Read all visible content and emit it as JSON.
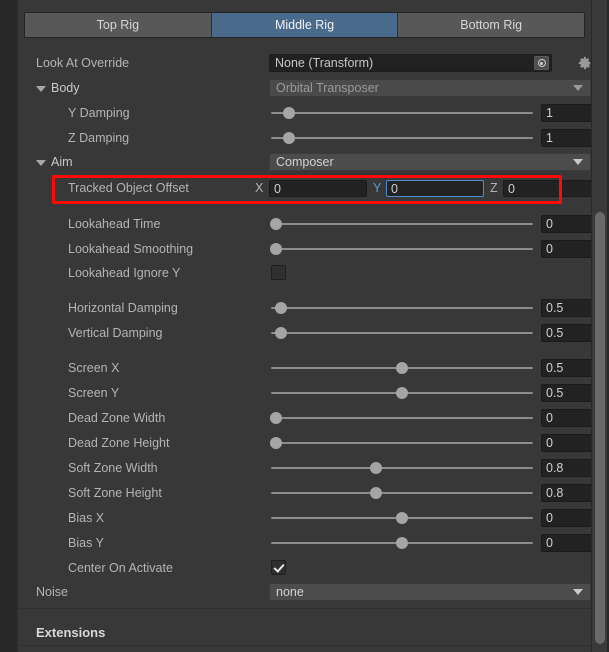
{
  "tabs": [
    {
      "label": "Top Rig",
      "selected": false
    },
    {
      "label": "Middle Rig",
      "selected": true
    },
    {
      "label": "Bottom Rig",
      "selected": false
    }
  ],
  "look_at_override": {
    "label": "Look At Override",
    "value": "None (Transform)",
    "picker_icon": "object-picker-icon",
    "settings_icon": "gear-icon"
  },
  "body": {
    "label": "Body",
    "value": "Orbital Transposer",
    "y_damping": {
      "label": "Y Damping",
      "value": "1",
      "slider_pct": 7
    },
    "z_damping": {
      "label": "Z Damping",
      "value": "1",
      "slider_pct": 7
    }
  },
  "aim": {
    "label": "Aim",
    "value": "Composer",
    "tracked_object_offset": {
      "label": "Tracked Object Offset",
      "x_axis": "X",
      "x_value": "0",
      "y_axis": "Y",
      "y_value": "0",
      "z_axis": "Z",
      "z_value": "0",
      "focused_field": "Y",
      "highlight_color": "#ff0a0a"
    },
    "fields": [
      {
        "name": "lookahead-time",
        "label": "Lookahead Time",
        "value": "0",
        "slider_pct": 2,
        "type": "slider"
      },
      {
        "name": "lookahead-smoothing",
        "label": "Lookahead Smoothing",
        "value": "0",
        "slider_pct": 2,
        "type": "slider"
      },
      {
        "name": "lookahead-ignore-y",
        "label": "Lookahead Ignore Y",
        "value": "",
        "checked": false,
        "type": "checkbox"
      },
      {
        "name": "horizontal-damping",
        "label": "Horizontal Damping",
        "value": "0.5",
        "slider_pct": 4,
        "type": "slider"
      },
      {
        "name": "vertical-damping",
        "label": "Vertical Damping",
        "value": "0.5",
        "slider_pct": 4,
        "type": "slider"
      },
      {
        "name": "screen-x",
        "label": "Screen X",
        "value": "0.5",
        "slider_pct": 50,
        "type": "slider"
      },
      {
        "name": "screen-y",
        "label": "Screen Y",
        "value": "0.5",
        "slider_pct": 50,
        "type": "slider"
      },
      {
        "name": "dead-zone-width",
        "label": "Dead Zone Width",
        "value": "0",
        "slider_pct": 2,
        "type": "slider"
      },
      {
        "name": "dead-zone-height",
        "label": "Dead Zone Height",
        "value": "0",
        "slider_pct": 2,
        "type": "slider"
      },
      {
        "name": "soft-zone-width",
        "label": "Soft Zone Width",
        "value": "0.8",
        "slider_pct": 40,
        "type": "slider"
      },
      {
        "name": "soft-zone-height",
        "label": "Soft Zone Height",
        "value": "0.8",
        "slider_pct": 40,
        "type": "slider"
      },
      {
        "name": "bias-x",
        "label": "Bias X",
        "value": "0",
        "slider_pct": 50,
        "type": "slider"
      },
      {
        "name": "bias-y",
        "label": "Bias Y",
        "value": "0",
        "slider_pct": 50,
        "type": "slider"
      },
      {
        "name": "center-on-activate",
        "label": "Center On Activate",
        "value": "",
        "checked": true,
        "type": "checkbox"
      }
    ]
  },
  "noise": {
    "label": "Noise",
    "value": "none"
  },
  "extensions": {
    "label": "Extensions"
  },
  "colors": {
    "panel_bg": "#383838",
    "window_bg": "#282828",
    "tab_selected": "#4a6a8c",
    "tab_normal": "#585858",
    "focus_border": "#4d8ccb",
    "axis_focus_label": "#5a9bd8",
    "highlight": "#ff0a0a"
  }
}
